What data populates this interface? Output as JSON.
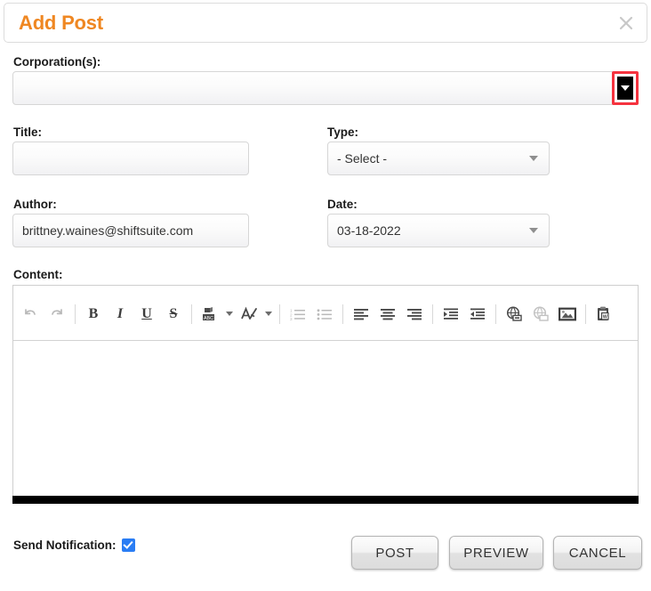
{
  "dialog": {
    "title": "Add Post",
    "close_icon": "close-icon",
    "accent_color": "#ef8722",
    "highlight_color": "#f5333f",
    "checkbox_color": "#2a7df4"
  },
  "form": {
    "corporations": {
      "label": "Corporation(s):",
      "value": "",
      "placeholder": "",
      "dropdown_icon": "chevron-down-icon",
      "highlighted": true
    },
    "title": {
      "label": "Title:",
      "value": "",
      "placeholder": ""
    },
    "type": {
      "label": "Type:",
      "value": "- Select -",
      "dropdown_icon": "chevron-down-icon"
    },
    "author": {
      "label": "Author:",
      "value": "brittney.waines@shiftsuite.com"
    },
    "date": {
      "label": "Date:",
      "value": "03-18-2022",
      "dropdown_icon": "chevron-down-icon"
    },
    "content": {
      "label": "Content:",
      "value": ""
    }
  },
  "toolbar": {
    "buttons": [
      {
        "name": "undo-icon",
        "title": "Undo",
        "disabled": true
      },
      {
        "name": "redo-icon",
        "title": "Redo",
        "disabled": true
      },
      {
        "name": "bold-icon",
        "title": "Bold",
        "glyph": "B"
      },
      {
        "name": "italic-icon",
        "title": "Italic",
        "glyph": "I"
      },
      {
        "name": "underline-icon",
        "title": "Underline",
        "glyph": "U"
      },
      {
        "name": "strikethrough-icon",
        "title": "Strikethrough",
        "glyph": "S"
      },
      {
        "name": "spellcheck-icon",
        "title": "Spell Check Abc",
        "has_caret": true
      },
      {
        "name": "text-format-icon",
        "title": "Text Format",
        "has_caret": true
      },
      {
        "name": "numbered-list-icon",
        "title": "Numbered List",
        "disabled": true
      },
      {
        "name": "bulleted-list-icon",
        "title": "Bulleted List",
        "disabled": true
      },
      {
        "name": "align-left-icon",
        "title": "Align Left"
      },
      {
        "name": "align-center-icon",
        "title": "Align Center"
      },
      {
        "name": "align-right-icon",
        "title": "Align Right"
      },
      {
        "name": "indent-icon",
        "title": "Increase Indent"
      },
      {
        "name": "outdent-icon",
        "title": "Decrease Indent"
      },
      {
        "name": "link-icon",
        "title": "Insert Link"
      },
      {
        "name": "unlink-icon",
        "title": "Remove Link",
        "disabled": true
      },
      {
        "name": "image-icon",
        "title": "Insert Image"
      },
      {
        "name": "paste-from-word-icon",
        "title": "Paste from Word"
      }
    ]
  },
  "footer": {
    "notification_label": "Send Notification:",
    "notification_checked": true,
    "post_label": "POST",
    "preview_label": "PREVIEW",
    "cancel_label": "CANCEL"
  }
}
